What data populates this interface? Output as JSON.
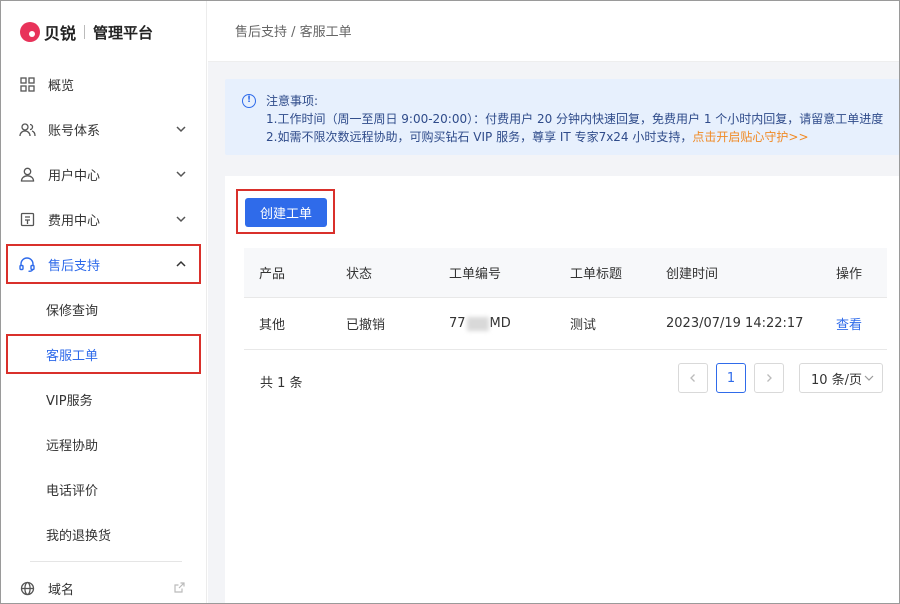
{
  "brand": {
    "name": "贝锐",
    "title": "管理平台"
  },
  "sidebar": {
    "items": [
      {
        "label": "概览",
        "icon": "grid-icon"
      },
      {
        "label": "账号体系",
        "icon": "users-icon"
      },
      {
        "label": "用户中心",
        "icon": "user-icon"
      },
      {
        "label": "费用中心",
        "icon": "wallet-icon"
      },
      {
        "label": "售后支持",
        "icon": "headset-icon"
      }
    ],
    "sub_items": [
      {
        "label": "保修查询"
      },
      {
        "label": "客服工单"
      },
      {
        "label": "VIP服务"
      },
      {
        "label": "远程协助"
      },
      {
        "label": "电话评价"
      },
      {
        "label": "我的退换货"
      }
    ],
    "domain": {
      "label": "域名",
      "icon": "globe-icon"
    }
  },
  "breadcrumb": "售后支持 / 客服工单",
  "notice": {
    "title": "注意事项:",
    "line1": "1.工作时间（周一至周日 9:00-20:00）：付费用户 20 分钟内快速回复，免费用户 1 个小时内回复，请留意工单进度",
    "line2": "2.如需不限次数远程协助，可购买钻石 VIP 服务，尊享 IT 专家7x24 小时支持，",
    "link": "点击开启贴心守护>>"
  },
  "create_button": "创建工单",
  "table": {
    "headers": [
      "产品",
      "状态",
      "工单编号",
      "工单标题",
      "创建时间",
      "操作"
    ],
    "rows": [
      {
        "product": "其他",
        "status": "已撤销",
        "id_prefix": "77",
        "id_suffix": "MD",
        "title": "测试",
        "created": "2023/07/19 14:22:17",
        "action": "查看"
      }
    ]
  },
  "pagination": {
    "total": "共 1 条",
    "current": "1",
    "page_size": "10 条/页"
  },
  "colors": {
    "accent": "#2f6bea",
    "highlight": "#d9302b",
    "link_orange": "#f08a25"
  }
}
